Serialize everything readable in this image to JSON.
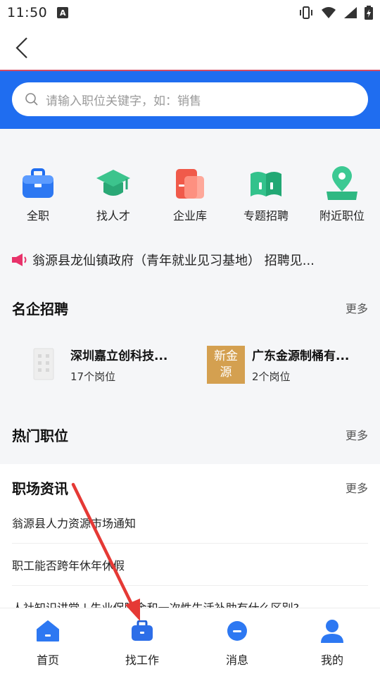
{
  "status_bar": {
    "time": "11:50",
    "notification_icon": "A"
  },
  "search": {
    "placeholder": "请输入职位关键字，如：销售"
  },
  "quick_links": [
    {
      "label": "全职",
      "icon": "briefcase-icon"
    },
    {
      "label": "找人才",
      "icon": "graduation-cap-icon"
    },
    {
      "label": "企业库",
      "icon": "company-library-icon"
    },
    {
      "label": "专题招聘",
      "icon": "book-icon"
    },
    {
      "label": "附近职位",
      "icon": "location-pin-icon"
    }
  ],
  "notice": {
    "text": "翁源县龙仙镇政府（青年就业见习基地） 招聘见..."
  },
  "famous_companies": {
    "title": "名企招聘",
    "more": "更多",
    "items": [
      {
        "name": "深圳嘉立创科技...",
        "count": "17个岗位",
        "logo_text": ""
      },
      {
        "name": "广东金源制桶有...",
        "count": "2个岗位",
        "logo_text": "新金源"
      }
    ]
  },
  "hot_jobs": {
    "title": "热门职位",
    "more": "更多"
  },
  "news": {
    "title": "职场资讯",
    "more": "更多",
    "items": [
      "翁源县人力资源市场通知",
      "职工能否跨年休年休假",
      "人社知识讲堂 | 失业保险金和一次性生活补助有什么区别?"
    ]
  },
  "tabs": [
    {
      "label": "首页",
      "icon": "home-icon"
    },
    {
      "label": "找工作",
      "icon": "briefcase-icon"
    },
    {
      "label": "消息",
      "icon": "message-icon"
    },
    {
      "label": "我的",
      "icon": "profile-icon"
    }
  ],
  "colors": {
    "brand_blue": "#1f6df0",
    "arrow": "#e53935",
    "gold": "#d4a050"
  }
}
